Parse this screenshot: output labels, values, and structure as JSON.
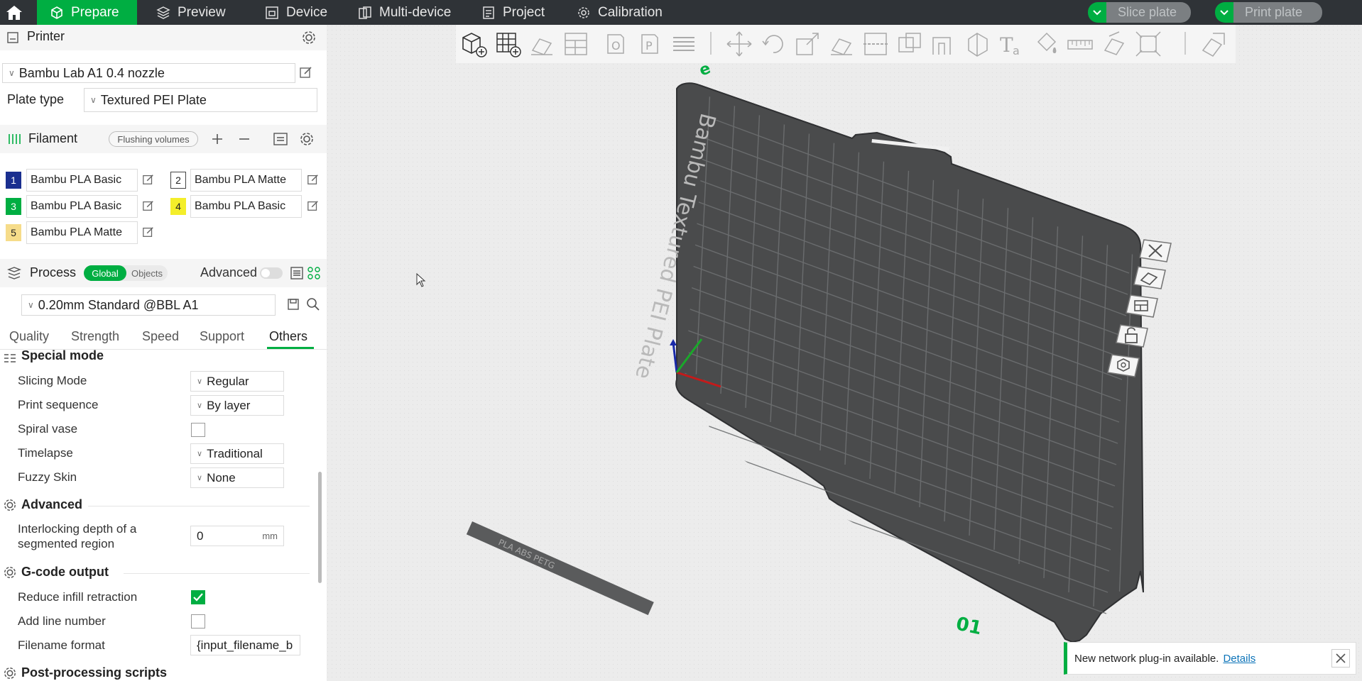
{
  "topbar": {
    "tabs": [
      {
        "label": "Prepare",
        "icon": "cube-icon",
        "active": true
      },
      {
        "label": "Preview",
        "icon": "layers-icon"
      },
      {
        "label": "Device",
        "icon": "device-icon"
      },
      {
        "label": "Multi-device",
        "icon": "multi-device-icon"
      },
      {
        "label": "Project",
        "icon": "project-icon"
      },
      {
        "label": "Calibration",
        "icon": "calibration-icon"
      }
    ],
    "slice_label": "Slice plate",
    "print_label": "Print plate"
  },
  "printer": {
    "title": "Printer",
    "preset": "Bambu Lab A1 0.4 nozzle",
    "plate_type_label": "Plate type",
    "plate_type": "Textured PEI Plate"
  },
  "filament": {
    "title": "Filament",
    "flushing_label": "Flushing volumes",
    "items": [
      {
        "num": "1",
        "name": "Bambu PLA Basic",
        "color": "#1a2f8f",
        "text_color": "#ffffff"
      },
      {
        "num": "2",
        "name": "Bambu PLA Matte",
        "color": "#ffffff",
        "text_color": "#222222"
      },
      {
        "num": "3",
        "name": "Bambu PLA Basic",
        "color": "#00ae42",
        "text_color": "#ffffff"
      },
      {
        "num": "4",
        "name": "Bambu PLA Basic",
        "color": "#f4ee2a",
        "text_color": "#222222"
      },
      {
        "num": "5",
        "name": "Bambu PLA Matte",
        "color": "#f6dc8a",
        "text_color": "#222222"
      }
    ]
  },
  "process": {
    "title": "Process",
    "toggle_global": "Global",
    "toggle_objects": "Objects",
    "advanced_label": "Advanced",
    "preset": "0.20mm Standard @BBL A1",
    "tabs": [
      "Quality",
      "Strength",
      "Speed",
      "Support",
      "Others"
    ],
    "active_tab": "Others"
  },
  "settings": {
    "special_mode": "Special mode",
    "slicing_mode_label": "Slicing Mode",
    "slicing_mode_value": "Regular",
    "print_sequence_label": "Print sequence",
    "print_sequence_value": "By layer",
    "spiral_vase_label": "Spiral vase",
    "timelapse_label": "Timelapse",
    "timelapse_value": "Traditional",
    "fuzzy_skin_label": "Fuzzy Skin",
    "fuzzy_skin_value": "None",
    "advanced_group": "Advanced",
    "interlocking_label_1": "Interlocking depth of a",
    "interlocking_label_2": "segmented region",
    "interlocking_value": "0",
    "interlocking_unit": "mm",
    "gcode_group": "G-code output",
    "reduce_infill_label": "Reduce infill retraction",
    "add_line_label": "Add line number",
    "filename_label": "Filename format",
    "filename_value": "{input_filename_b",
    "postproc_group": "Post-processing scripts"
  },
  "plate": {
    "title_text": "Bambu Textured PEI Plate",
    "corner_number": "01",
    "material_text": "PLA ABS PETG"
  },
  "notification": {
    "text": "New network plug-in available.",
    "link": "Details"
  }
}
